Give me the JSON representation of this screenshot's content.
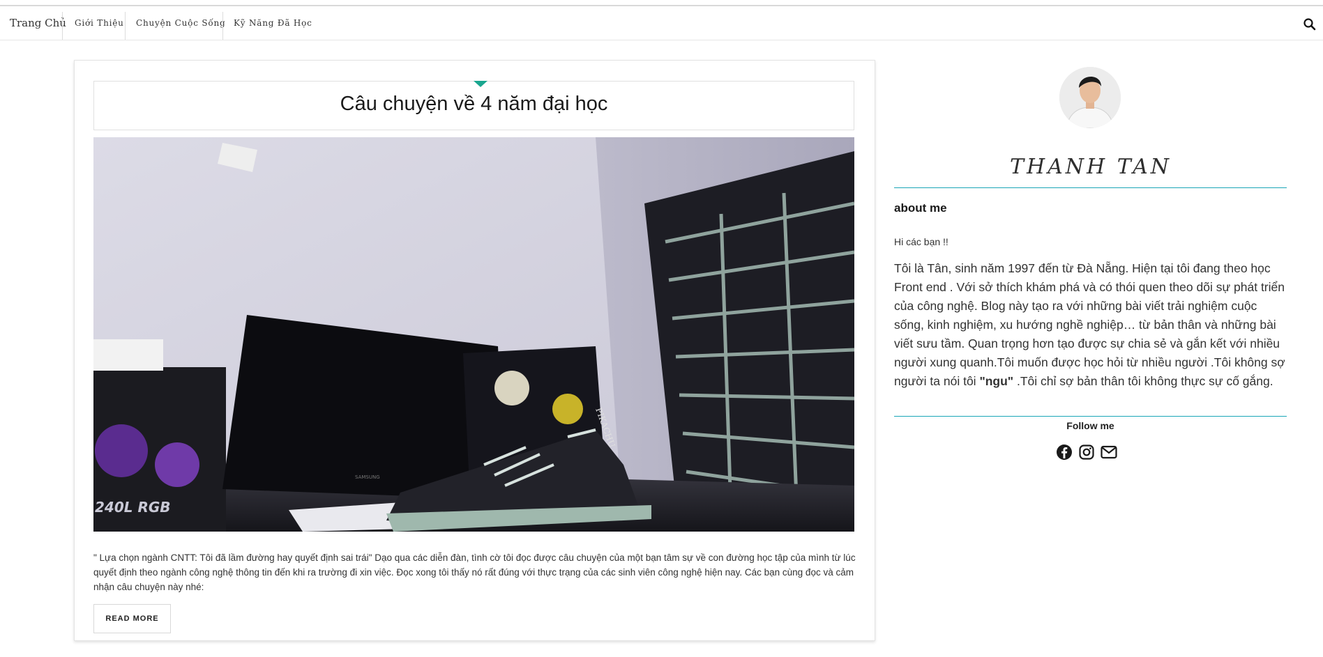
{
  "nav": {
    "home": "Trang Chủ",
    "items": [
      "Giới Thiệu",
      "Chuyện Cuộc Sống",
      "Kỹ Năng Đã Học"
    ],
    "search_icon": "search-icon"
  },
  "post": {
    "title": "Câu chuyện về 4 năm đại học",
    "excerpt": "\" Lựa chọn ngành CNTT: Tôi đã lầm đường hay quyết định sai trái\" Dạo qua các diễn đàn, tình cờ tôi đọc được câu chuyện của một bạn tâm sự về con đường học tập của mình từ lúc quyết định theo ngành công nghệ thông tin đến khi ra trường đi xin việc. Đọc xong tôi thấy nó rất đúng với thực trạng của các sinh viên công nghệ hiện nay. Các bạn cùng đọc và cảm nhận câu chuyện này nhé:",
    "read_more": "READ MORE",
    "image": {
      "cooler_label": "240L RGB",
      "monitor_brand": "SAMSUNG",
      "sticker_text": "PIKACHU"
    }
  },
  "sidebar": {
    "author": "THANH TAN",
    "about_heading": "about me",
    "greeting": "Hi các bạn !!",
    "bio_before": "Tôi là Tân, sinh năm 1997 đến từ Đà Nẵng. Hiện tại tôi đang theo học Front end . Với sở thích khám phá và có thói quen theo dõi sự phát triển của công nghệ. Blog này tạo ra với những bài viết trải nghiệm cuộc sống, kinh nghiệm, xu hướng nghề nghiệp… từ bản thân và những bài viết sưu tầm. Quan trọng hơn tạo được sự chia sẻ và gắn kết với nhiều người xung quanh.Tôi muốn được học hỏi từ nhiều người .Tôi không sợ người ta nói tôi ",
    "bio_bold": "\"ngu\"",
    "bio_after": " .Tôi chỉ sợ bản thân tôi không thực sự cố gắng.",
    "follow_label": "Follow me",
    "social_icons": [
      "facebook-icon",
      "instagram-icon",
      "mail-icon"
    ]
  },
  "colors": {
    "accent": "#1aa68f",
    "rule": "#1aa6b7",
    "text": "#333333"
  }
}
